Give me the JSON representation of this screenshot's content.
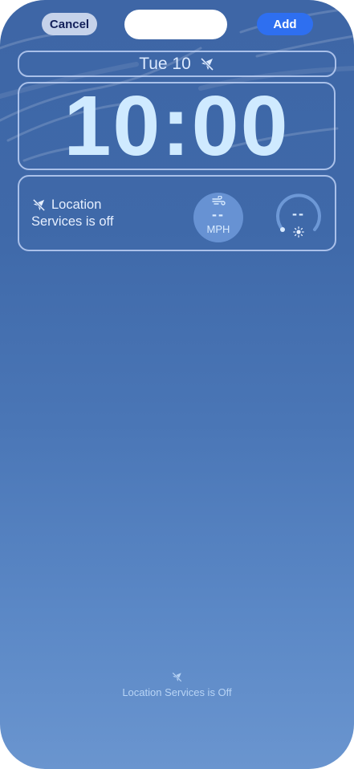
{
  "toolbar": {
    "cancel_label": "Cancel",
    "add_label": "Add"
  },
  "date_widget": {
    "text": "Tue 10",
    "icon": "location-off-icon"
  },
  "clock": {
    "time": "10:00"
  },
  "widgets": {
    "location": {
      "icon": "location-off-icon",
      "line1": "Location",
      "line2": "Services is off"
    },
    "wind": {
      "icon": "wind-icon",
      "value": "--",
      "unit": "MPH"
    },
    "uv": {
      "value": "--",
      "icon": "sun-icon"
    }
  },
  "footer": {
    "icon": "location-off-icon",
    "text": "Location Services is Off"
  },
  "colors": {
    "cancel_bg": "#c5d2ea",
    "add_bg": "#2e6ff0",
    "wallpaper_top": "#3e66a6",
    "wallpaper_bottom": "#6a95cf"
  }
}
